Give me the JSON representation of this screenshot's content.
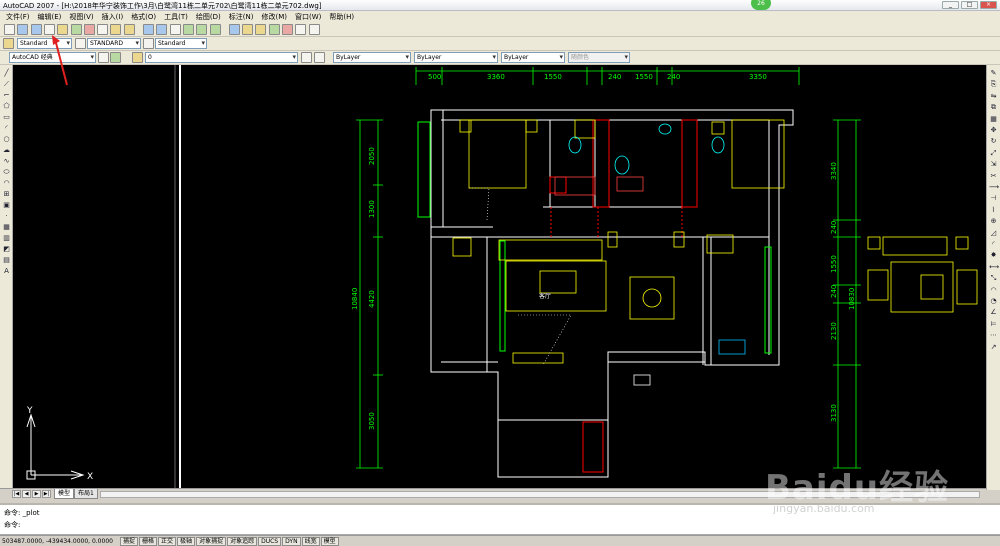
{
  "window": {
    "title": "AutoCAD 2007 - [H:\\2018年华宁装饰工作\\3月\\白鹭湾11栋二单元702\\白鹭湾11栋二单元702.dwg]",
    "badge": "26"
  },
  "menu": [
    "文件(F)",
    "编辑(E)",
    "视图(V)",
    "插入(I)",
    "格式(O)",
    "工具(T)",
    "绘图(D)",
    "标注(N)",
    "修改(M)",
    "窗口(W)",
    "帮助(H)"
  ],
  "styles": {
    "text_style": "Standard",
    "dim_style": "STANDARD",
    "table_style": "Standard"
  },
  "workspace": "AutoCAD 经典",
  "layer": "0",
  "properties": {
    "color": "ByLayer",
    "linetype": "ByLayer",
    "lineweight": "ByLayer",
    "plotstyle": "随颜色"
  },
  "drawing": {
    "top_dims": [
      "500",
      "3360",
      "1550",
      "240",
      "1550",
      "240",
      "3350"
    ],
    "left_dims": [
      "2050",
      "1300",
      "4420",
      "3050"
    ],
    "overall_left": "10840",
    "right_dims": [
      "3340",
      "240",
      "1550",
      "240",
      "2130",
      "3130"
    ],
    "overall_right": "10830",
    "room_label": "客厅"
  },
  "ucs": {
    "x": "X",
    "y": "Y"
  },
  "tabs": [
    "模型",
    "布局1"
  ],
  "command_lines": [
    "命令: _plot",
    "命令:"
  ],
  "status": {
    "coords": "503487.0000, -439434.0000, 0.0000",
    "buttons": [
      "捕捉",
      "栅格",
      "正交",
      "极轴",
      "对象捕捉",
      "对象追踪",
      "DUCS",
      "DYN",
      "线宽",
      "模型"
    ]
  },
  "watermark": {
    "brand": "Baidu经验",
    "url": "jingyan.baidu.com"
  },
  "colors": {
    "canvas": "#000000",
    "walls": "#ffffff",
    "dims": "#00ff00",
    "furniture": "#ffff00",
    "doors": "#ff0000",
    "accent": "#00bfff"
  }
}
